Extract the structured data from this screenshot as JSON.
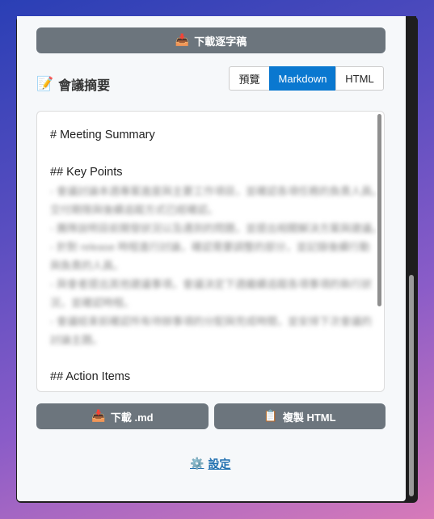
{
  "toolbar": {
    "download_transcript_label": "下載逐字稿",
    "download_transcript_icon": "inbox-tray-icon"
  },
  "summary": {
    "title": "會議摘要",
    "title_icon": "memo-icon",
    "tabs": [
      {
        "label": "預覽",
        "active": false
      },
      {
        "label": "Markdown",
        "active": true
      },
      {
        "label": "HTML",
        "active": false
      }
    ]
  },
  "markdown": {
    "lines": [
      {
        "text": "# Meeting Summary",
        "blurred": false
      },
      {
        "text": "",
        "blurred": false
      },
      {
        "text": "## Key Points",
        "blurred": false
      },
      {
        "text": "- 會議討論本週專案進度與主要工作項目，並確認各項任務的負責人員。",
        "blurred": true
      },
      {
        "text": "交付期限與後續追蹤方式已經確認。",
        "blurred": true
      },
      {
        "text": "- 團隊說明目前開發狀況以及遇到的問題，並提出相關解決方案與建議。",
        "blurred": true
      },
      {
        "text": "- 針對 release 時程進行討論，確認需要調整的部分，並記錄後續行動",
        "blurred": true
      },
      {
        "text": "與負責的人員。",
        "blurred": true
      },
      {
        "text": "- 與會者提出其他建議事項，會議決定下週繼續追蹤各項事項的執行狀",
        "blurred": true
      },
      {
        "text": "況，並確認時程。",
        "blurred": true
      },
      {
        "text": "- 會議結束前確認所有待辦事項的分配與完成時間，並安排下次會議的",
        "blurred": true
      },
      {
        "text": "討論主題。",
        "blurred": true
      },
      {
        "text": "",
        "blurred": false
      },
      {
        "text": "## Action Items",
        "blurred": false
      }
    ]
  },
  "actions": {
    "download_md_label": "下載 .md",
    "download_md_icon": "inbox-tray-icon",
    "copy_html_label": "複製 HTML",
    "copy_html_icon": "clipboard-icon"
  },
  "footer": {
    "settings_label": "設定",
    "settings_icon": "gear-icon"
  },
  "colors": {
    "primary_button": "#6c757d",
    "active_tab": "#0a78d0",
    "link": "#1f6fb0"
  }
}
